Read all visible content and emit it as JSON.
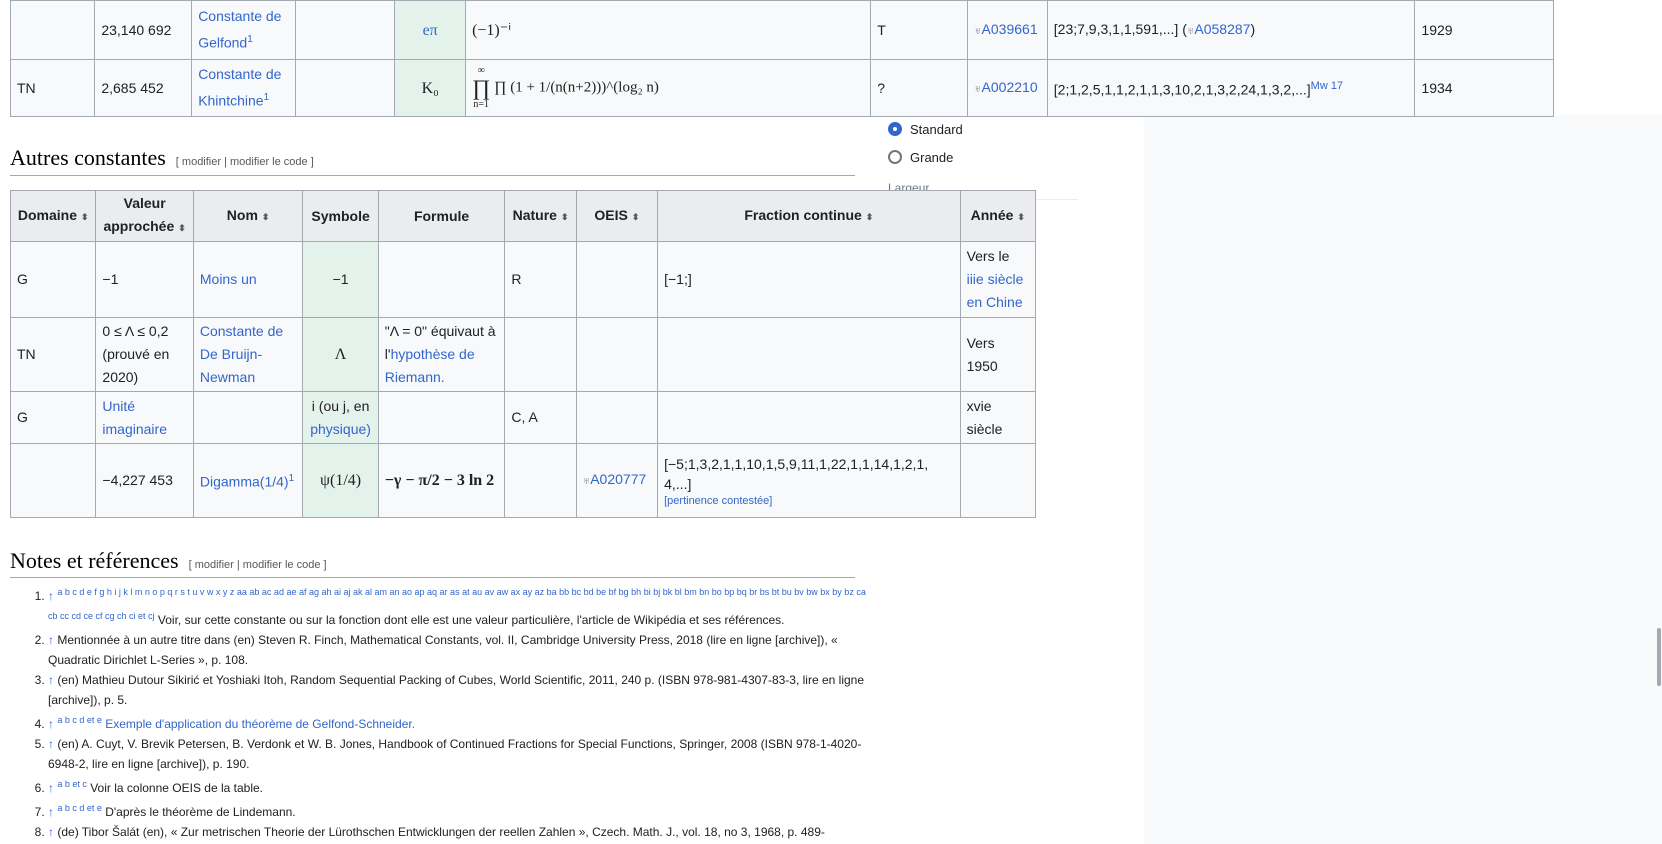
{
  "top_table": {
    "rows": [
      {
        "domaine": "",
        "valeur": "23,140 692",
        "nom": "Constante de Gelfond",
        "nom_sup": "1",
        "symbole": "eπ",
        "formule": "(−1)⁻ⁱ",
        "nature": "T",
        "oeis": "A039661",
        "fraction": "[23;7,9,3,1,1,591,...]",
        "fraction_link": "A058287",
        "annee": "1929"
      },
      {
        "domaine": "TN",
        "valeur": "2,685 452",
        "nom": "Constante de Khintchine",
        "nom_sup": "1",
        "symbole": "K₀",
        "formule": "∏ (1 + 1/(n(n+2)))^(log₂ n)",
        "formule_limits_top": "∞",
        "formule_limits_bottom": "n=1",
        "nature": "?",
        "oeis": "A002210",
        "fraction": "[2;1,2,5,1,1,2,1,1,3,10,2,1,3,2,24,1,3,2,...]",
        "fraction_sup": "Mw 17",
        "annee": "1934"
      }
    ]
  },
  "section_autres": {
    "title": "Autres constantes",
    "edit": "[ modifier | modifier le code ]"
  },
  "table": {
    "headers": [
      "Domaine",
      "Valeur approchée",
      "Nom",
      "Symbole",
      "Formule",
      "Nature",
      "OEIS",
      "Fraction continue",
      "Année"
    ],
    "rows": [
      {
        "domaine": "G",
        "valeur": "−1",
        "nom": "Moins un",
        "symbole": "−1",
        "formule": "",
        "nature": "R",
        "oeis": "",
        "fraction": "[−1;]",
        "annee_prefix": "Vers le",
        "annee_link": "iiie siècle en Chine"
      },
      {
        "domaine": "TN",
        "valeur": "0 ≤ Λ ≤ 0,2 (prouvé en 2020)",
        "nom": "Constante de De Bruijn-Newman",
        "symbole": "Λ",
        "formule_text": "\"Λ = 0\" équivaut à l'",
        "formule_link": "hypothèse de Riemann.",
        "nature": "",
        "oeis": "",
        "fraction": "",
        "annee": "Vers 1950"
      },
      {
        "domaine": "G",
        "valeur": "Unité imaginaire",
        "nom": "",
        "symbole_text": "i (ou j, en ",
        "symbole_link": "physique)",
        "formule": "",
        "nature": "C, A",
        "oeis": "",
        "fraction": "",
        "annee": "xvie siècle"
      },
      {
        "domaine": "",
        "valeur": "−4,227 453",
        "nom": "Digamma(1/4)",
        "nom_sup": "1",
        "symbole": "ψ(1/4)",
        "formule": "−γ − π/2 − 3 ln 2",
        "nature": "",
        "oeis": "A020777",
        "fraction": "[−5;1,3,2,1,1,10,1,5,9,11,1,22,1,1,14,1,2,1,4,...]",
        "fraction_note": "[pertinence contestée]",
        "annee": ""
      }
    ]
  },
  "radio": {
    "standard": "Standard",
    "grande": "Grande",
    "largeur": "Largeur"
  },
  "section_notes": {
    "title": "Notes et références",
    "edit": "[ modifier | modifier le code ]"
  },
  "refs": [
    {
      "letters": "a b c d e f g h i j k l m n o p q r s t u v w x y z aa ab ac ad ae af ag ah ai aj ak al am an ao ap aq ar as at au av aw ax ay az ba bb bc bd be bf bg bh bi bj bk bl bm bn bo bp bq br bs bt bu bv bw bx by bz ca cb cc cd ce cf cg ch ci et cj",
      "text": "Voir, sur cette constante ou sur la fonction dont elle est une valeur particulière, l'article de Wikipédia et ses références."
    },
    {
      "text": "Mentionnée à un autre titre dans (en) Steven R. Finch, Mathematical Constants, vol. II, Cambridge University Press, 2018 (lire en ligne [archive]), « Quadratic Dirichlet L-Series », p. 108."
    },
    {
      "text": "(en) Mathieu Dutour Sikirić et Yoshiaki Itoh, Random Sequential Packing of Cubes, World Scientific, 2011, 240 p. (ISBN 978-981-4307-83-3, lire en ligne [archive]), p. 5."
    },
    {
      "letters": "a b c d et e",
      "text": "Exemple d'application du théorème de Gelfond-Schneider."
    },
    {
      "text": "(en) A. Cuyt, V. Brevik Petersen, B. Verdonk et W. B. Jones, Handbook of Continued Fractions for Special Functions, Springer, 2008 (ISBN 978-1-4020-6948-2, lire en ligne [archive]), p. 190."
    },
    {
      "letters": "a b et c",
      "text": "Voir la colonne OEIS de la table."
    },
    {
      "letters": "a b c d et e",
      "text": "D'après le théorème de Lindemann."
    },
    {
      "text": "(de) Tibor Šalát (en), « Zur metrischen Theorie der Lürothschen Entwicklungen der reellen Zahlen », Czech. Math. J., vol. 18, no 3, 1968, p. 489-"
    }
  ]
}
